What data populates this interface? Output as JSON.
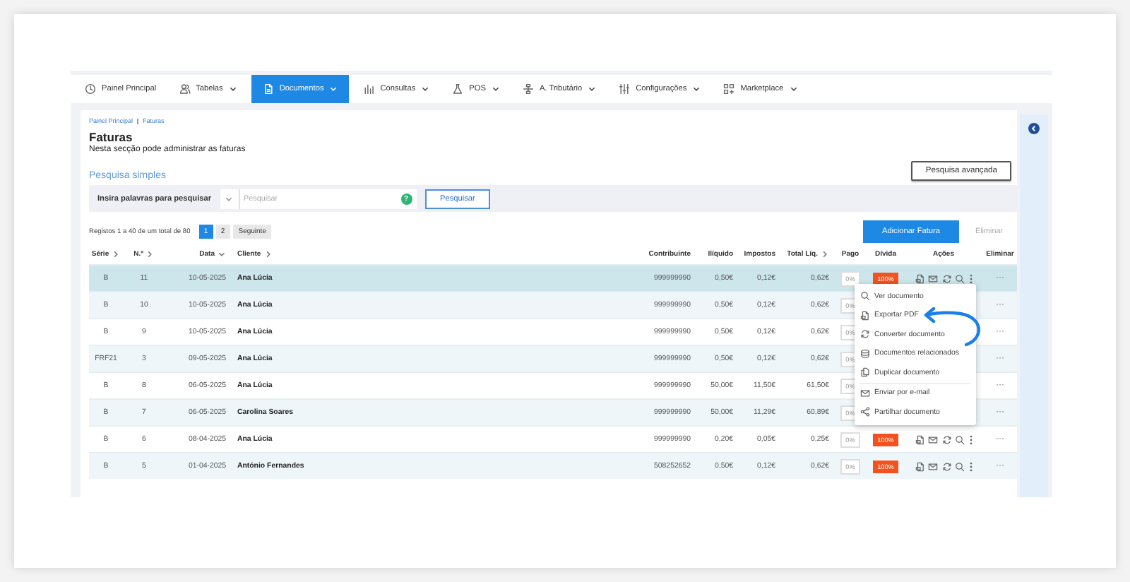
{
  "nav": {
    "items": [
      {
        "label": "Painel Principal",
        "selected": false,
        "dropdown": false
      },
      {
        "label": "Tabelas",
        "selected": false,
        "dropdown": true
      },
      {
        "label": "Documentos",
        "selected": true,
        "dropdown": true
      },
      {
        "label": "Consultas",
        "selected": false,
        "dropdown": true
      },
      {
        "label": "POS",
        "selected": false,
        "dropdown": true
      },
      {
        "label": "A. Tributário",
        "selected": false,
        "dropdown": true
      },
      {
        "label": "Configurações",
        "selected": false,
        "dropdown": true
      },
      {
        "label": "Marketplace",
        "selected": false,
        "dropdown": true
      }
    ]
  },
  "breadcrumb": [
    "Painel Principal",
    "Faturas"
  ],
  "title": "Faturas",
  "subtitle": "Nesta secção pode administrar as faturas",
  "search": {
    "heading": "Pesquisa simples",
    "advanced_button": "Pesquisa avançada",
    "label": "Insira palavras para pesquisar",
    "placeholder": "Pesquisar",
    "help": "?",
    "button": "Pesquisar"
  },
  "pagination": {
    "summary": "Registos 1 a 40 de um total de 80",
    "pages": [
      {
        "label": "1",
        "selected": true
      },
      {
        "label": "2",
        "selected": false
      }
    ],
    "next": "Seguinte"
  },
  "add_button": "Adicionar Fatura",
  "delete_button": {
    "label": "Eliminar",
    "disabled": true
  },
  "table": {
    "columns": [
      {
        "label": "Série",
        "sortable": true,
        "descending": false
      },
      {
        "label": "N.º",
        "sortable": true,
        "descending": false
      },
      {
        "label": "Data",
        "sortable": true,
        "descending": true
      },
      {
        "label": "Cliente",
        "sortable": true,
        "descending": false
      },
      {
        "label": "Contribuinte",
        "sortable": false
      },
      {
        "label": "Ilíquido",
        "sortable": false
      },
      {
        "label": "Impostos",
        "sortable": false
      },
      {
        "label": "Total Líq.",
        "sortable": true,
        "descending": false
      },
      {
        "label": "Pago",
        "sortable": false
      },
      {
        "label": "Dívida",
        "sortable": false
      },
      {
        "label": "Ações",
        "sortable": false
      },
      {
        "label": "Eliminar",
        "sortable": false
      }
    ],
    "rows": [
      {
        "serie": "B",
        "numero": "11",
        "data": "10-05-2025",
        "cliente": "Ana Lúcia",
        "contribuinte": "999999990",
        "iliquido": "0,50€",
        "impostos": "0,12€",
        "total": "0,62€",
        "pago": "0%",
        "divida": "100%",
        "actions": true,
        "more": "···",
        "selected": true
      },
      {
        "serie": "B",
        "numero": "10",
        "data": "10-05-2025",
        "cliente": "Ana Lúcia",
        "contribuinte": "999999990",
        "iliquido": "0,50€",
        "impostos": "0,12€",
        "total": "0,62€",
        "pago": "0%",
        "actions": false,
        "more": "···",
        "selected": false
      },
      {
        "serie": "B",
        "numero": "9",
        "data": "10-05-2025",
        "cliente": "Ana Lúcia",
        "contribuinte": "999999990",
        "iliquido": "0,50€",
        "impostos": "0,12€",
        "total": "0,62€",
        "pago": "0%",
        "actions": false,
        "more": "···",
        "selected": false
      },
      {
        "serie": "FRF21",
        "numero": "3",
        "data": "09-05-2025",
        "cliente": "Ana Lúcia",
        "contribuinte": "999999990",
        "iliquido": "0,50€",
        "impostos": "0,12€",
        "total": "0,62€",
        "pago": "0%",
        "actions": false,
        "more": "···",
        "selected": false
      },
      {
        "serie": "B",
        "numero": "8",
        "data": "06-05-2025",
        "cliente": "Ana Lúcia",
        "contribuinte": "999999990",
        "iliquido": "50,00€",
        "impostos": "11,50€",
        "total": "61,50€",
        "pago": "0%",
        "actions": false,
        "more": "···",
        "selected": false
      },
      {
        "serie": "B",
        "numero": "7",
        "data": "06-05-2025",
        "cliente": "Carolina Soares",
        "contribuinte": "999999990",
        "iliquido": "50,00€",
        "impostos": "11,29€",
        "total": "60,89€",
        "pago": "0%",
        "actions": false,
        "more": "···",
        "selected": false
      },
      {
        "serie": "B",
        "numero": "6",
        "data": "08-04-2025",
        "cliente": "Ana Lúcia",
        "contribuinte": "999999990",
        "iliquido": "0,20€",
        "impostos": "0,05€",
        "total": "0,25€",
        "pago": "0%",
        "divida": "100%",
        "actions": true,
        "more": "···",
        "selected": false
      },
      {
        "serie": "B",
        "numero": "5",
        "data": "01-04-2025",
        "cliente": "António Fernandes",
        "contribuinte": "508252652",
        "iliquido": "0,50€",
        "impostos": "0,12€",
        "total": "0,62€",
        "pago": "0%",
        "divida": "100%",
        "actions": true,
        "more": "···",
        "selected": false
      }
    ]
  },
  "action_menu": {
    "items": [
      {
        "label": "Ver documento",
        "separated": false
      },
      {
        "label": "Exportar PDF",
        "separated": false
      },
      {
        "label": "Converter documento",
        "separated": false
      },
      {
        "label": "Documentos relacionados",
        "separated": false
      },
      {
        "label": "Duplicar documento",
        "separated": false
      },
      {
        "label": "Enviar por e-mail",
        "separated": true
      },
      {
        "label": "Partilhar documento",
        "separated": false
      }
    ]
  }
}
